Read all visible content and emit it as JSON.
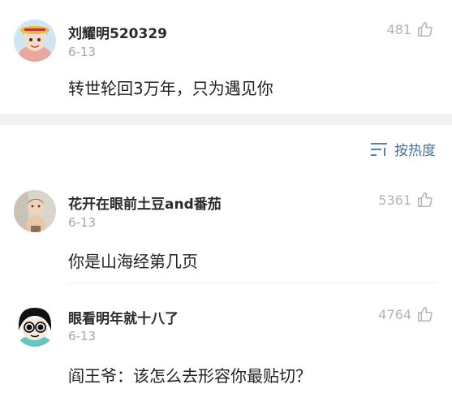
{
  "comments": [
    {
      "username": "刘耀明520329",
      "date": "6-13",
      "likes": "481",
      "text": "转世轮回3万年，只为遇见你"
    },
    {
      "username": "花开在眼前土豆and番茄",
      "date": "6-13",
      "likes": "5361",
      "text": "你是山海经第几页"
    },
    {
      "username": "眼看明年就十八了",
      "date": "6-13",
      "likes": "4764",
      "text": "阎王爷：该怎么去形容你最贴切？"
    }
  ],
  "sort": {
    "label": "按热度",
    "icon": "sort-lines-icon"
  },
  "colors": {
    "link": "#4a6f9c",
    "muted": "#a6a6a6",
    "band": "#f2f2f2"
  }
}
